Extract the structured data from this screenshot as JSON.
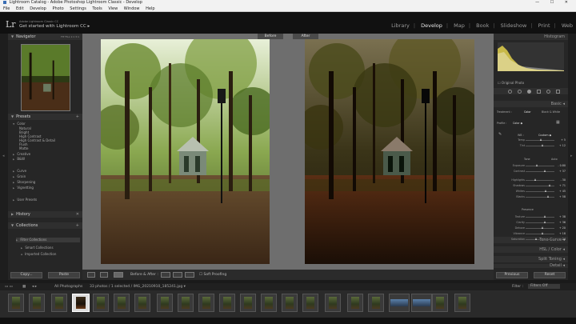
{
  "window": {
    "title": "Lightroom Catalog - Adobe Photoshop Lightroom Classic - Develop",
    "controls": "— ☐ ✕"
  },
  "menu": [
    "File",
    "Edit",
    "Develop",
    "Photo",
    "Settings",
    "Tools",
    "View",
    "Window",
    "Help"
  ],
  "identity": {
    "logo": "Lr",
    "subtitle": "Adobe Lightroom Classic CC",
    "status": "Get started with Lightroom CC ▸"
  },
  "modules": [
    {
      "label": "Library",
      "active": false
    },
    {
      "label": "Develop",
      "active": true
    },
    {
      "label": "Map",
      "active": false
    },
    {
      "label": "Book",
      "active": false
    },
    {
      "label": "Slideshow",
      "active": false
    },
    {
      "label": "Print",
      "active": false
    },
    {
      "label": "Web",
      "active": false
    }
  ],
  "left": {
    "navigator": {
      "title": "Navigator",
      "zoom": "FIT  FILL  1:1  3:1"
    },
    "presets": {
      "title": "Presets",
      "groups": [
        "Color",
        "Creative",
        "B&W",
        "Curve",
        "Grain",
        "Sharpening",
        "Vignetting",
        "User Presets"
      ],
      "color_items": [
        "Natural",
        "Bright",
        "High Contrast",
        "High Contrast & Detail",
        "Flush",
        "Matte"
      ]
    },
    "history": {
      "title": "History"
    },
    "collections": {
      "title": "Collections",
      "items": [
        "Filter Collections",
        "Smart Collections",
        "Imported Collection"
      ]
    },
    "copy_label": "Copy...",
    "paste_label": "Paste"
  },
  "view": {
    "before_label": "Before",
    "after_label": "After",
    "toolbar_mode": "Before & After :",
    "soft_proofing": "Soft Proofing"
  },
  "filmbar": {
    "pages": "1  2",
    "source": "All Photographs",
    "count": "33 photos / 1 selected / IMG_20210910_185241.jpg ▾",
    "filter_label": "Filter :",
    "filter_value": "Filters Off"
  },
  "right": {
    "histogram_title": "Histogram",
    "original_photo": "Original Photo",
    "basic_title": "Basic ◂",
    "treatment_label": "Treatment :",
    "treatment_color": "Color",
    "treatment_bw": "Black & White",
    "profile_label": "Profile :",
    "profile_value": "Color ◆",
    "wb_label": "WB :",
    "wb_value": "Custom ◆",
    "tone_label": "Tone",
    "tone_auto": "Auto",
    "presence_label": "Presence",
    "sliders": [
      {
        "label": "Temp",
        "value": "+ 5",
        "pos": 0.55
      },
      {
        "label": "Tint",
        "value": "+ 12",
        "pos": 0.6
      },
      {
        "label": "Exposure",
        "value": "- 0.80",
        "pos": 0.4
      },
      {
        "label": "Contrast",
        "value": "+ 37",
        "pos": 0.68
      },
      {
        "label": "Highlights",
        "value": "- 30",
        "pos": 0.36
      },
      {
        "label": "Shadows",
        "value": "+ 71",
        "pos": 0.85
      },
      {
        "label": "Whites",
        "value": "+ 45",
        "pos": 0.72
      },
      {
        "label": "Blacks",
        "value": "+ 58",
        "pos": 0.78
      },
      {
        "label": "Texture",
        "value": "+ 38",
        "pos": 0.69
      },
      {
        "label": "Clarity",
        "value": "+ 36",
        "pos": 0.68
      },
      {
        "label": "Dehaze",
        "value": "+ 20",
        "pos": 0.6
      },
      {
        "label": "Vibrance",
        "value": "+ 18",
        "pos": 0.59
      },
      {
        "label": "Saturation",
        "value": "- 24",
        "pos": 0.38
      }
    ],
    "tone_curve": "Tone Curve ◂",
    "hsl": "HSL / Color ◂",
    "split_toning": "Split Toning ◂",
    "detail": "Detail ◂",
    "previous_label": "Previous",
    "reset_label": "Reset"
  }
}
